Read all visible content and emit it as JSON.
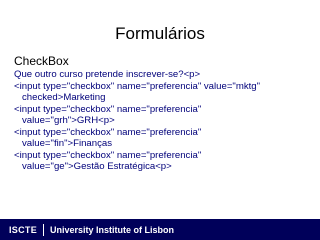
{
  "slide": {
    "title": "Formulários",
    "subtitle": "CheckBox",
    "code_lines": [
      "Que outro curso pretende inscrever-se?<p>",
      "<input type=\"checkbox\" name=\"preferencia\" value=\"mktg\"",
      "   checked>Marketing",
      "<input type=\"checkbox\" name=\"preferencia\"",
      "   value=\"grh\">GRH<p>",
      "<input type=\"checkbox\" name=\"preferencia\"",
      "   value=\"fin\">Finanças",
      "<input type=\"checkbox\" name=\"preferencia\"",
      "   value=\"ge\">Gestão Estratégica<p>"
    ]
  },
  "footer": {
    "logo": "ISCTE",
    "institution": "University Institute of Lisbon"
  },
  "colors": {
    "code_text": "#00007a",
    "footer_bg": "#00005a",
    "footer_text": "#ffffff"
  }
}
